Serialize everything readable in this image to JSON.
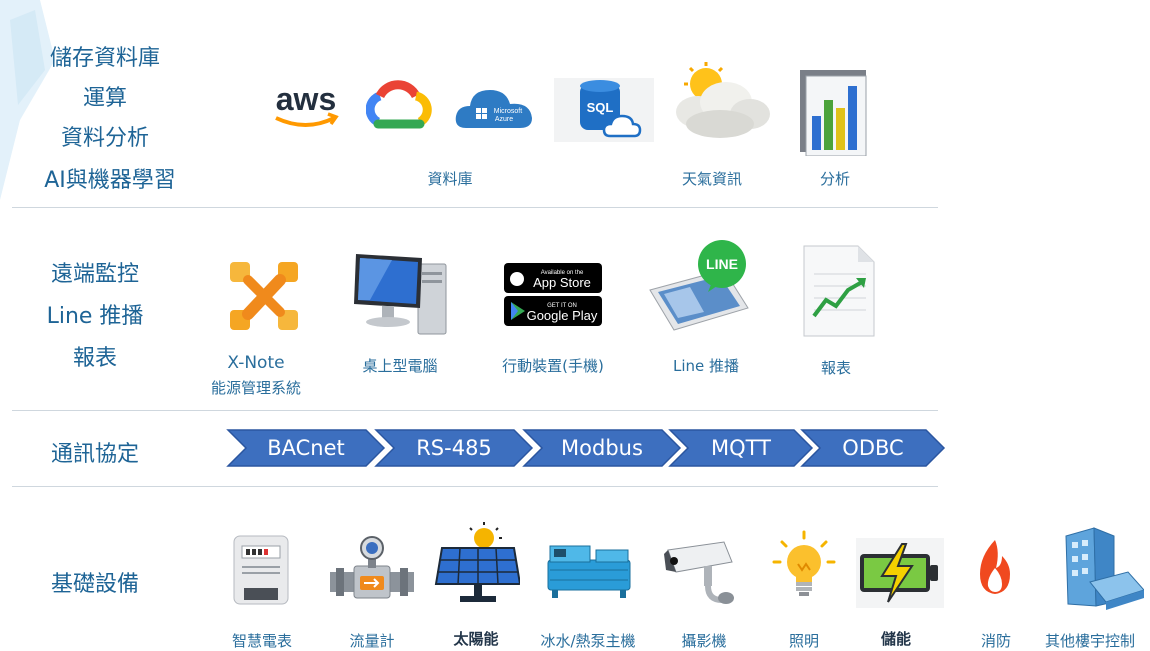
{
  "layers": {
    "cloud": {
      "labels": [
        "儲存資料庫",
        "運算",
        "資料分析",
        "AI與機器學習"
      ],
      "icons": {
        "aws_text": "aws",
        "azure_text1": "Microsoft",
        "azure_text2": "Azure",
        "sql_text": "SQL"
      },
      "captions": [
        "資料庫",
        "天氣資訊",
        "分析"
      ]
    },
    "monitor": {
      "labels": [
        "遠端監控",
        "Line 推播",
        "報表"
      ],
      "captions": [
        "X-Note",
        "能源管理系統",
        "桌上型電腦",
        "行動裝置(手機)",
        "Line 推播",
        "報表"
      ],
      "badges": {
        "appstore_small": "Available on the",
        "appstore": "App Store",
        "googleplay_small": "GET IT ON",
        "googleplay": "Google Play",
        "line": "LINE"
      }
    },
    "protocol": {
      "label": "通訊協定",
      "items": [
        "BACnet",
        "RS-485",
        "Modbus",
        "MQTT",
        "ODBC"
      ]
    },
    "devices": {
      "label": "基礎設備",
      "captions": [
        "智慧電表",
        "流量計",
        "太陽能",
        "冰水/熱泵主機",
        "攝影機",
        "照明",
        "儲能",
        "消防",
        "其他樓宇控制"
      ]
    }
  },
  "colors": {
    "label_text": "#1e6496",
    "chevron_fill": "#3d6fbf",
    "chevron_stroke": "#2b56a0",
    "divider": "#cfd7de"
  }
}
